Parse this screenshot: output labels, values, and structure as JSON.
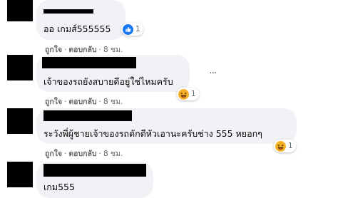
{
  "comments": [
    {
      "text": "ออ เกมส์555555",
      "reaction": {
        "icon": "like-icon",
        "color": "#1877f2",
        "count": "1"
      },
      "actions": {
        "like": "ถูกใจ",
        "reply": "ตอบกลับ",
        "time": "8 ชม."
      }
    },
    {
      "text": "เจ้าของรถยังสบายดีอยู่ใช่ไหมครับ",
      "reaction": {
        "icon": "haha-icon",
        "color": "#f7b125",
        "count": "1"
      },
      "actions": {
        "like": "ถูกใจ",
        "reply": "ตอบกลับ",
        "time": "8 ชม."
      },
      "more": "···"
    },
    {
      "text": "ระวังพี่ผู้ชายเจ้าของรถดักตีหัวเอานะครับช่าง 555 หยอกๆ",
      "reaction": {
        "icon": "haha-icon",
        "color": "#f7b125",
        "count": "1"
      },
      "actions": {
        "like": "ถูกใจ",
        "reply": "ตอบกลับ",
        "time": "8 ชม."
      }
    },
    {
      "text": "เกม555"
    }
  ],
  "separator": "·"
}
